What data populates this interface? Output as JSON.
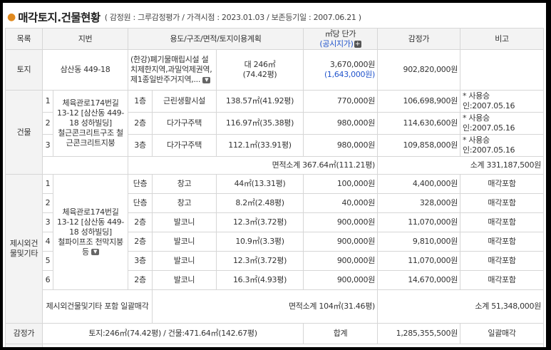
{
  "header": {
    "title": "매각토지.건물현황",
    "subtitle": "( 감정원 : 그루감정평가 / 가격시점 : 2023.01.03 / 보존등기일 : 2007.06.21 )"
  },
  "columns": {
    "category": "목록",
    "address": "지번",
    "usage": "용도/구조/면적/토지이용계획",
    "unit_price": "㎡당 단가",
    "unit_price_sub": "(공시지가)",
    "appraisal": "감정가",
    "note": "비고"
  },
  "land": {
    "label": "토지",
    "address": "삼산동 449-18",
    "plan": "(한강)폐기물매립시설 설치제한지역,과밀억제권역,제1종일반주거지역,...",
    "area": "대 246㎡",
    "area_pyeong": "(74.42평)",
    "unit_price": "3,670,000원",
    "official_price": "(1,643,000원)",
    "appraisal": "902,820,000원"
  },
  "building": {
    "label": "건물",
    "address": "체육관로174번길 13-12 [삼산동 449-18 성하빌딩]",
    "structure": "철근콘크리트구조 철근콘크리트지붕",
    "rows": [
      {
        "no": "1",
        "floor": "1층",
        "usage": "근린생활시설",
        "area": "138.57㎡(41.92평)",
        "unit_price": "770,000원",
        "appraisal": "106,698,900원",
        "note": "* 사용승인:2007.05.16"
      },
      {
        "no": "2",
        "floor": "2층",
        "usage": "다가구주택",
        "area": "116.97㎡(35.38평)",
        "unit_price": "980,000원",
        "appraisal": "114,630,600원",
        "note": "* 사용승인:2007.05.16"
      },
      {
        "no": "3",
        "floor": "3층",
        "usage": "다가구주택",
        "area": "112.1㎡(33.91평)",
        "unit_price": "980,000원",
        "appraisal": "109,858,000원",
        "note": "* 사용승인:2007.05.16"
      }
    ],
    "area_subtotal": "면적소계 367.64㎡(111.21평)",
    "subtotal": "소계 331,187,500원"
  },
  "extra": {
    "label": "제시외건물및기타",
    "address": "체육관로174번길 13-12 [삼산동 449-18 성하빌딩]",
    "structure": "철파이프조 천막지붕 등",
    "rows": [
      {
        "no": "1",
        "floor": "단층",
        "usage": "창고",
        "area": "44㎡(13.31평)",
        "unit_price": "100,000원",
        "appraisal": "4,400,000원",
        "note": "매각포함"
      },
      {
        "no": "2",
        "floor": "단층",
        "usage": "창고",
        "area": "8.2㎡(2.48평)",
        "unit_price": "40,000원",
        "appraisal": "328,000원",
        "note": "매각포함"
      },
      {
        "no": "3",
        "floor": "2층",
        "usage": "발코니",
        "area": "12.3㎡(3.72평)",
        "unit_price": "900,000원",
        "appraisal": "11,070,000원",
        "note": "매각포함"
      },
      {
        "no": "4",
        "floor": "2층",
        "usage": "발코니",
        "area": "10.9㎡(3.3평)",
        "unit_price": "900,000원",
        "appraisal": "9,810,000원",
        "note": "매각포함"
      },
      {
        "no": "5",
        "floor": "3층",
        "usage": "발코니",
        "area": "12.3㎡(3.72평)",
        "unit_price": "900,000원",
        "appraisal": "11,070,000원",
        "note": "매각포함"
      },
      {
        "no": "6",
        "floor": "2층",
        "usage": "발코니",
        "area": "16.3㎡(4.93평)",
        "unit_price": "900,000원",
        "appraisal": "14,670,000원",
        "note": "매각포함"
      }
    ],
    "bulk_note": "제시외건물및기타 포함 일괄매각",
    "area_subtotal": "면적소계 104㎡(31.46평)",
    "subtotal": "소계 51,348,000원"
  },
  "total": {
    "label": "감정가",
    "summary": "토지:246㎡(74.42평) / 건물:471.64㎡(142.67평)",
    "sum_label": "합계",
    "amount": "1,285,355,500원",
    "note": "일괄매각"
  }
}
